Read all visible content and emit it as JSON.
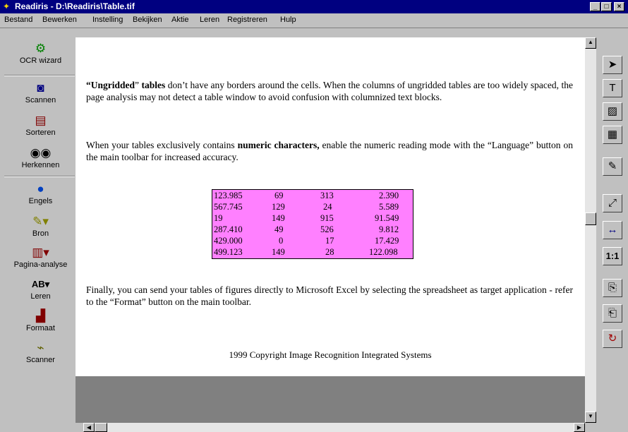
{
  "window": {
    "title": "Readiris - D:\\Readiris\\Table.tif",
    "minimize": "_",
    "maximize": "□",
    "close": "×"
  },
  "menu": [
    "Bestand",
    "Bewerken",
    "Instelling",
    "Bekijken",
    "Aktie",
    "Leren",
    "Registreren",
    "Hulp"
  ],
  "left_toolbar": [
    {
      "label": "OCR wizard",
      "icon": "gears-icon"
    },
    {
      "label": "Scannen",
      "icon": "camera-icon"
    },
    {
      "label": "Sorteren",
      "icon": "sort-icon"
    },
    {
      "label": "Herkennen",
      "icon": "eyes-icon"
    },
    {
      "label": "Engels",
      "icon": "globe-icon"
    },
    {
      "label": "Bron",
      "icon": "source-icon"
    },
    {
      "label": "Pagina-analyse",
      "icon": "page-layout-icon"
    },
    {
      "label": "Leren",
      "icon": "learn-ab-icon"
    },
    {
      "label": "Formaat",
      "icon": "format-icon"
    },
    {
      "label": "Scanner",
      "icon": "scanner-icon"
    }
  ],
  "document": {
    "para1_bold": "“Ungridded",
    "para1_normal1": "” ",
    "para1_bold2": "tables",
    "para1_rest": " don’t have any borders around the cells. When the columns of ungridded tables are too widely spaced, the page analysis may not detect a table window to avoid confusion with columnized text blocks.",
    "para2_a": "When your tables exclusively contains ",
    "para2_bold": "numeric characters,",
    "para2_b": " enable the numeric reading mode with the “Language” button on the main toolbar for increased accuracy.",
    "table_rows": [
      [
        "123.985",
        "69",
        "313",
        "2.390"
      ],
      [
        "567.745",
        "129",
        "24",
        "5.589"
      ],
      [
        "19",
        "149",
        "915",
        "91.549"
      ],
      [
        "287.410",
        "49",
        "526",
        "9.812"
      ],
      [
        "429.000",
        "0",
        "17",
        "17.429"
      ],
      [
        "499.123",
        "149",
        "28",
        "122.098"
      ]
    ],
    "para3": "Finally, you can send your tables of figures directly to Microsoft Excel by selecting the spreadsheet as target application - refer to the “Format” button on the main toolbar.",
    "copyright": "1999 Copyright Image Recognition Integrated Systems"
  },
  "right_toolbar": [
    {
      "name": "select-arrow-icon",
      "glyph": "➤"
    },
    {
      "name": "text-zone-icon",
      "glyph": "T"
    },
    {
      "name": "graphic-zone-icon",
      "glyph": "▨"
    },
    {
      "name": "table-zone-icon",
      "glyph": "▦"
    },
    {
      "name": "auto-zone-icon",
      "glyph": "✎"
    },
    {
      "name": "zoom-page-icon",
      "glyph": "⤢"
    },
    {
      "name": "fit-width-icon",
      "glyph": "↔"
    },
    {
      "name": "actual-size-icon",
      "glyph": "1:1"
    },
    {
      "name": "copy-page-icon",
      "glyph": "⎘"
    },
    {
      "name": "export-page-icon",
      "glyph": "⎗"
    },
    {
      "name": "rotate-page-icon",
      "glyph": "↻"
    }
  ],
  "colors": {
    "titlebar": "#000080",
    "table_fill": "#ff80ff",
    "workspace": "#808080"
  }
}
